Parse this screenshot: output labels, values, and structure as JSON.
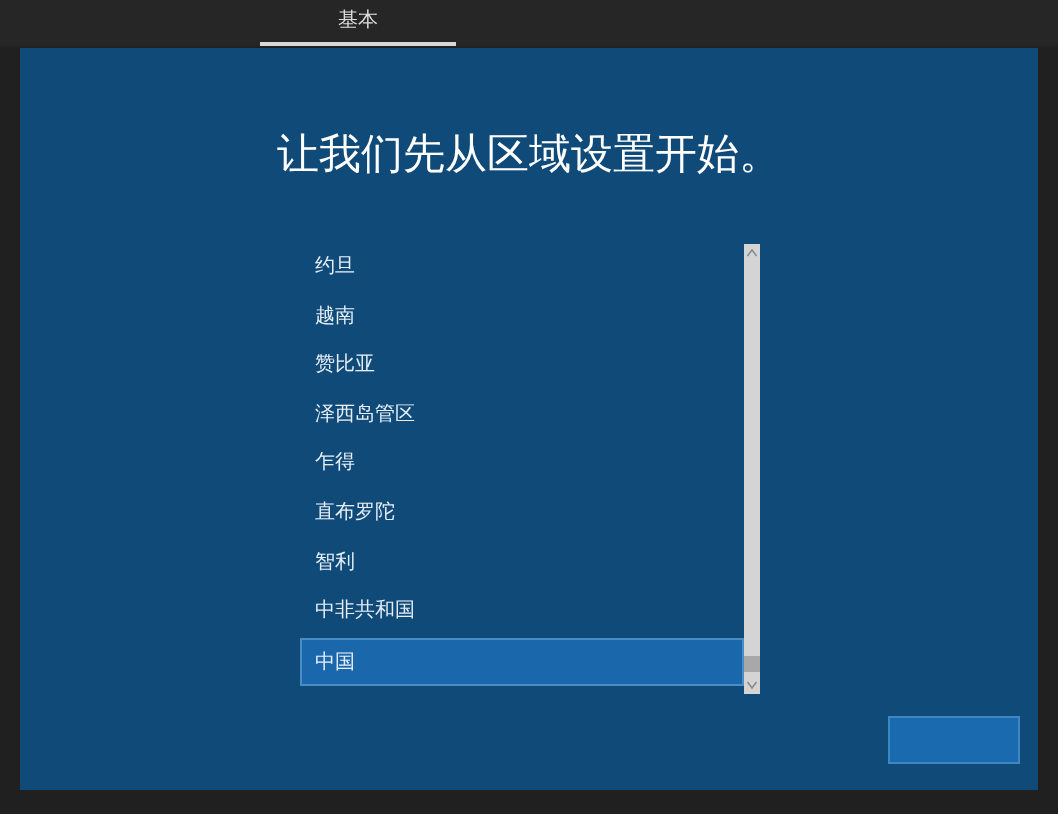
{
  "tabs": [
    {
      "label": "基本",
      "selected": true
    }
  ],
  "title": "让我们先从区域设置开始。",
  "regions": [
    {
      "label": "约旦",
      "selected": false
    },
    {
      "label": "越南",
      "selected": false
    },
    {
      "label": "赞比亚",
      "selected": false
    },
    {
      "label": "泽西岛管区",
      "selected": false
    },
    {
      "label": "乍得",
      "selected": false
    },
    {
      "label": "直布罗陀",
      "selected": false
    },
    {
      "label": "智利",
      "selected": false
    },
    {
      "label": "中非共和国",
      "selected": false
    },
    {
      "label": "中国",
      "selected": true
    }
  ]
}
